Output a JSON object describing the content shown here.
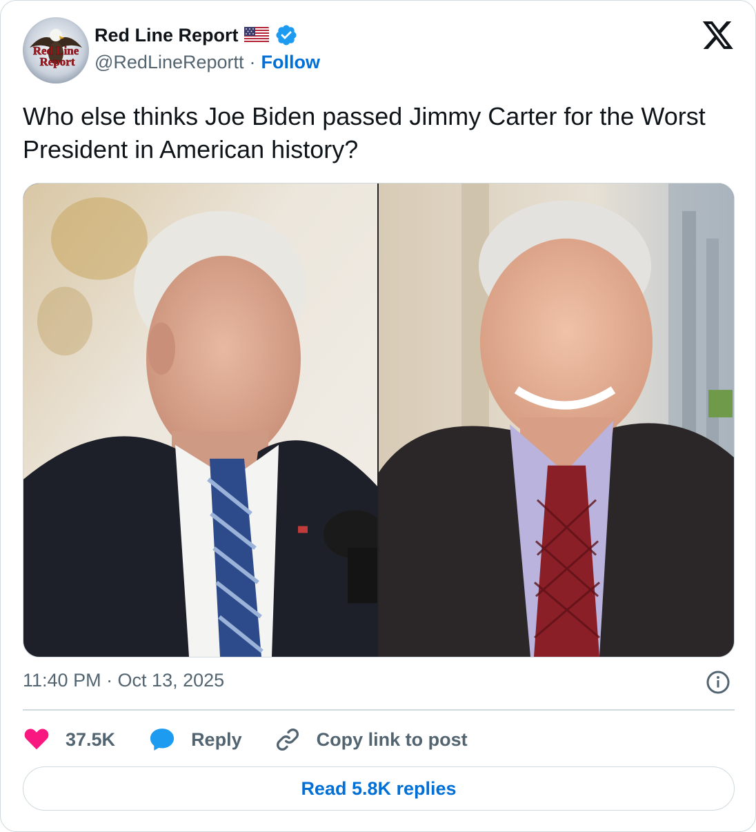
{
  "author": {
    "display_name": "Red Line Report",
    "handle": "@RedLineReportt",
    "separator": "·",
    "follow_label": "Follow",
    "avatar_text": "Red Line Report",
    "flag_emoji": "us-flag-icon",
    "verified": true
  },
  "tweet": {
    "text": "Who else thinks Joe Biden passed Jimmy Carter for the Worst President in American history?",
    "timestamp": "11:40 PM · Oct 13, 2025"
  },
  "media": {
    "photos": [
      "left-photo",
      "right-photo"
    ]
  },
  "actions": {
    "likes_count": "37.5K",
    "reply_label": "Reply",
    "copy_link_label": "Copy link to post",
    "read_replies_label": "Read 5.8K replies"
  },
  "colors": {
    "accent": "#006fd6",
    "like": "#f91880",
    "reply_icon": "#1d9bf0",
    "muted": "#536471",
    "border": "#cfd9de"
  }
}
